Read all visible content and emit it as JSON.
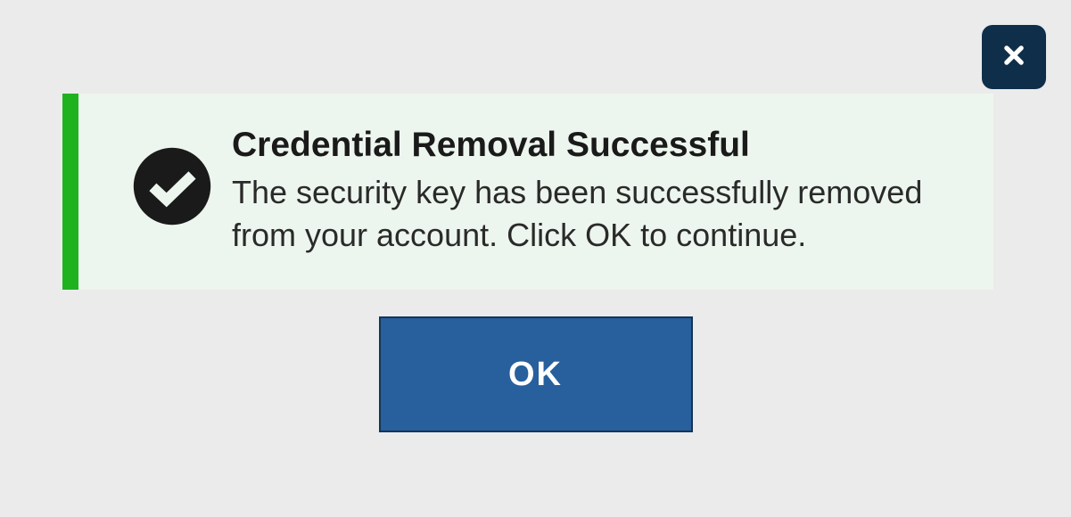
{
  "dialog": {
    "title": "Credential Removal Successful",
    "message": "The security key has been successfully removed from your account. Click OK to continue.",
    "ok_label": "OK"
  },
  "colors": {
    "accent_green": "#1fb21f",
    "alert_bg": "#edf6ee",
    "ok_bg": "#285f9d",
    "close_bg": "#0f2e4a"
  }
}
